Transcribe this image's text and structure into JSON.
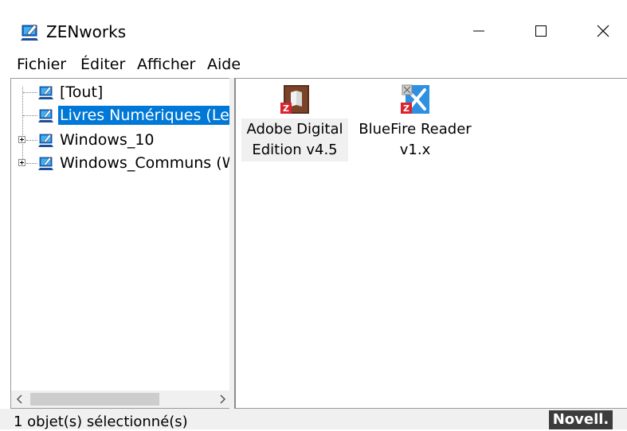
{
  "window": {
    "title": "ZENworks"
  },
  "menu": {
    "items": [
      "Fichier",
      "Éditer",
      "Afficher",
      "Aide"
    ]
  },
  "tree": {
    "items": [
      {
        "label": "[Tout]",
        "selected": false,
        "expandable": false
      },
      {
        "label": "Livres Numériques (Lect",
        "selected": true,
        "expandable": false
      },
      {
        "label": "Windows_10",
        "selected": false,
        "expandable": true
      },
      {
        "label": "Windows_Communs (W",
        "selected": false,
        "expandable": true
      }
    ]
  },
  "apps": [
    {
      "label_line1": "Adobe Digital",
      "label_line2": "Edition v4.5",
      "selected": true,
      "icon": "adobe-digital-editions-icon"
    },
    {
      "label_line1": "BlueFire Reader",
      "label_line2": "v1.x",
      "selected": false,
      "icon": "bluefire-reader-icon"
    }
  ],
  "status": {
    "text": "1 objet(s) sélectionné(s)",
    "brand": "Novell."
  },
  "colors": {
    "selection": "#0078d7",
    "status_bg": "#f0f0f0",
    "brand_bg": "#3c3c3c"
  }
}
